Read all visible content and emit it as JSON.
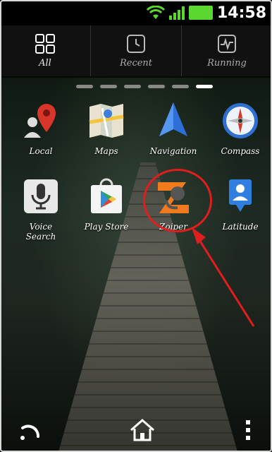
{
  "status": {
    "time": "14:58"
  },
  "tabs": [
    {
      "label": "All",
      "icon": "grid-icon"
    },
    {
      "label": "Recent",
      "icon": "clock-icon"
    },
    {
      "label": "Running",
      "icon": "pulse-icon"
    }
  ],
  "apps": [
    {
      "label": "Local",
      "icon": "local-pin-icon"
    },
    {
      "label": "Maps",
      "icon": "maps-icon"
    },
    {
      "label": "Navigation",
      "icon": "navigation-arrow-icon"
    },
    {
      "label": "Compass",
      "icon": "compass-icon"
    },
    {
      "label": "Voice Search",
      "icon": "microphone-icon"
    },
    {
      "label": "Play Store",
      "icon": "play-store-icon"
    },
    {
      "label": "Zoiper",
      "icon": "zoiper-icon"
    },
    {
      "label": "Latitude",
      "icon": "latitude-icon"
    }
  ],
  "colors": {
    "highlight": "#e01e1e",
    "signal": "#5bd82f"
  }
}
